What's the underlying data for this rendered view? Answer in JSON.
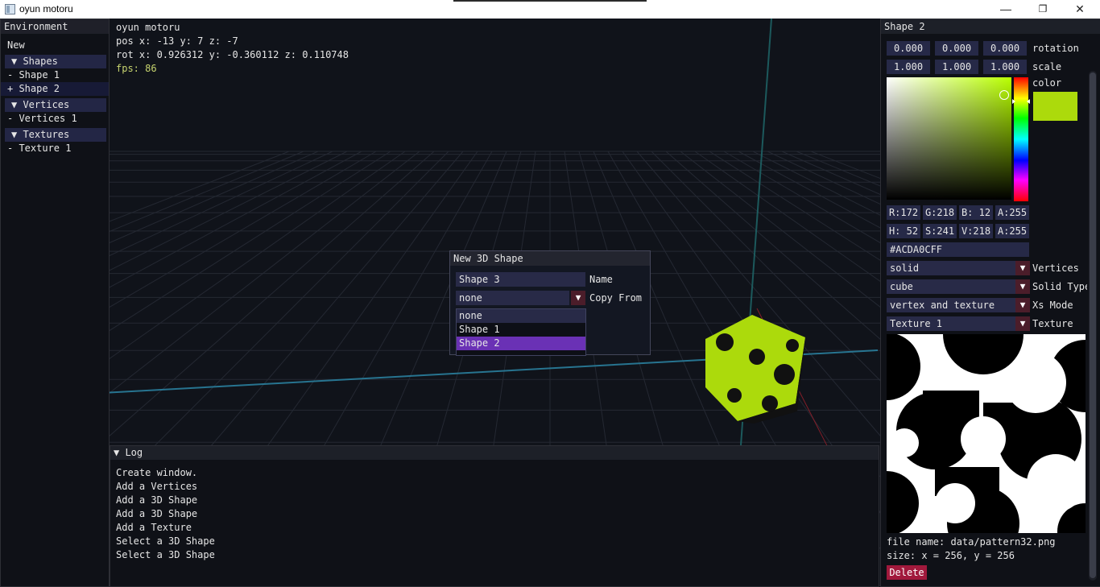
{
  "window": {
    "title": "oyun motoru"
  },
  "env": {
    "header": "Environment",
    "new_label": "New",
    "shapes_section": "▼  Shapes",
    "shape1": "- Shape 1",
    "shape2": "+ Shape 2",
    "vertices_section": "▼  Vertices",
    "vertices1": "- Vertices 1",
    "textures_section": "▼  Textures",
    "texture1": "- Texture 1"
  },
  "hud": {
    "title": "oyun motoru",
    "pos": "pos x: -13 y: 7 z: -7",
    "rot": "rot x: 0.926312 y: -0.360112 z: 0.110748",
    "fps": "fps: 86"
  },
  "modal": {
    "header": "New 3D Shape",
    "name_value": "Shape 3",
    "name_label": "Name",
    "copy_value": "none",
    "copy_label": "Copy From",
    "options": [
      "none",
      "Shape 1",
      "Shape 2"
    ]
  },
  "log": {
    "header": "▼ Log",
    "entries": [
      "Create window.",
      "Add a Vertices",
      "Add a 3D Shape",
      "Add a 3D Shape",
      "Add a Texture",
      "Select a 3D Shape",
      "Select a 3D Shape"
    ]
  },
  "shape_panel": {
    "header": "Shape 2",
    "rotation": [
      "0.000",
      "0.000",
      "0.000"
    ],
    "rotation_label": "rotation",
    "scale": [
      "1.000",
      "1.000",
      "1.000"
    ],
    "scale_label": "scale",
    "color_label": "color",
    "rgba": [
      "R:172",
      "G:218",
      "B: 12",
      "A:255"
    ],
    "hsva": [
      "H: 52",
      "S:241",
      "V:218",
      "A:255"
    ],
    "hex": "#ACDA0CFF",
    "vertices_value": "solid",
    "vertices_label": "Vertices",
    "solid_value": "cube",
    "solid_label": "Solid Type",
    "xs_value": "vertex and texture",
    "xs_label": "Xs Mode",
    "texture_value": "Texture 1",
    "texture_label": "Texture",
    "file_name": "file name: data/pattern32.png",
    "size": "size: x = 256, y = 256",
    "delete": "Delete"
  },
  "colors": {
    "accent": "#6a31b5",
    "selected_color": "#ACDA0C",
    "delete": "#a1193c"
  }
}
